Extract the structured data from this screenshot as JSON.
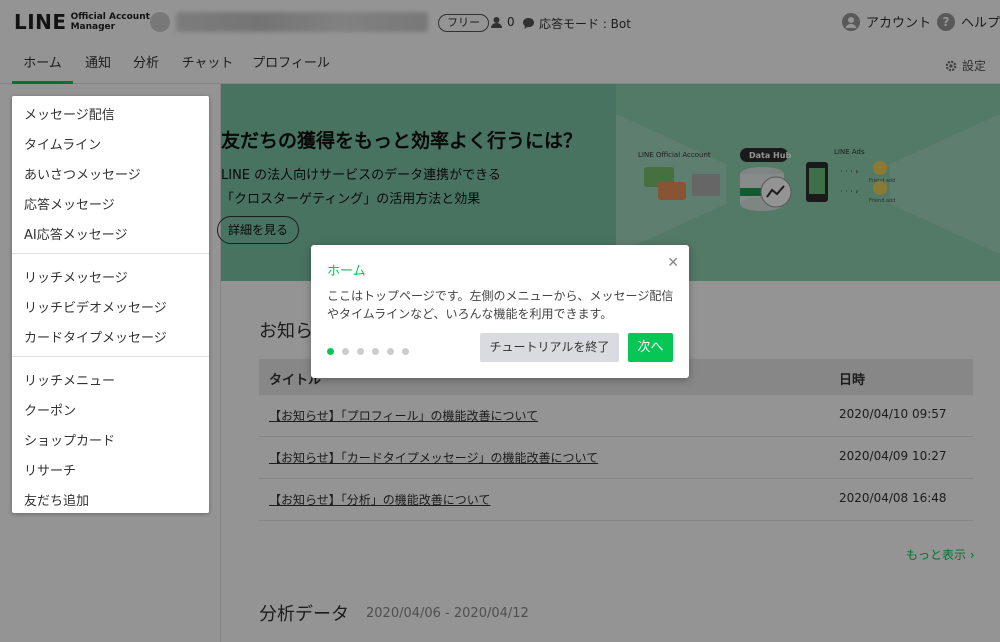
{
  "header": {
    "logo_main": "LINE",
    "logo_sub_line1": "Official Account",
    "logo_sub_line2": "Manager",
    "plan_badge": "フリー",
    "friend_count": "0",
    "mode_label": "応答モード : Bot",
    "account_label": "アカウント",
    "help_label": "ヘルプ"
  },
  "nav": {
    "tabs": [
      {
        "label": "ホーム"
      },
      {
        "label": "通知"
      },
      {
        "label": "分析"
      },
      {
        "label": "チャット"
      },
      {
        "label": "プロフィール"
      }
    ],
    "settings_label": "設定"
  },
  "banner": {
    "title": "友だちの獲得をもっと効率よく行うには？",
    "line1": "LINE の法人向けサービスのデータ連携ができる",
    "line2": "「クロスターゲティング」の活用方法と効果",
    "button_label": "詳細を見る",
    "art_left_label": "LINE Official Account",
    "art_center_label": "Data Hub",
    "art_right_label": "LINE Ads",
    "art_friend_label": "Friend add"
  },
  "menu": {
    "group1": [
      "メッセージ配信",
      "タイムライン",
      "あいさつメッセージ",
      "応答メッセージ",
      "AI応答メッセージ"
    ],
    "group2": [
      "リッチメッセージ",
      "リッチビデオメッセージ",
      "カードタイプメッセージ"
    ],
    "group3": [
      "リッチメニュー",
      "クーポン",
      "ショップカード",
      "リサーチ",
      "友だち追加"
    ]
  },
  "news": {
    "section_title": "お知らせ",
    "col_title": "タイトル",
    "col_date": "日時",
    "rows": [
      {
        "title": "【お知らせ】「プロフィール」の機能改善について",
        "date": "2020/04/10 09:57"
      },
      {
        "title": "【お知らせ】「カードタイプメッセージ」の機能改善について",
        "date": "2020/04/09 10:27"
      },
      {
        "title": "【お知らせ】「分析」の機能改善について",
        "date": "2020/04/08 16:48"
      }
    ],
    "more_label": "もっと表示"
  },
  "analysis": {
    "title": "分析データ",
    "range": "2020/04/06 - 2020/04/12"
  },
  "dialog": {
    "title": "ホーム",
    "body": "ここはトップページです。左側のメニューから、メッセージ配信やタイムラインなど、いろんな機能を利用できます。",
    "end_button": "チュートリアルを終了",
    "next_button": "次へ",
    "step_count": 6,
    "current_step": 1
  },
  "colors": {
    "accent": "#06c755",
    "banner_bg": "#7ec6a8",
    "overlay": "rgba(0,0,0,0.42)"
  }
}
